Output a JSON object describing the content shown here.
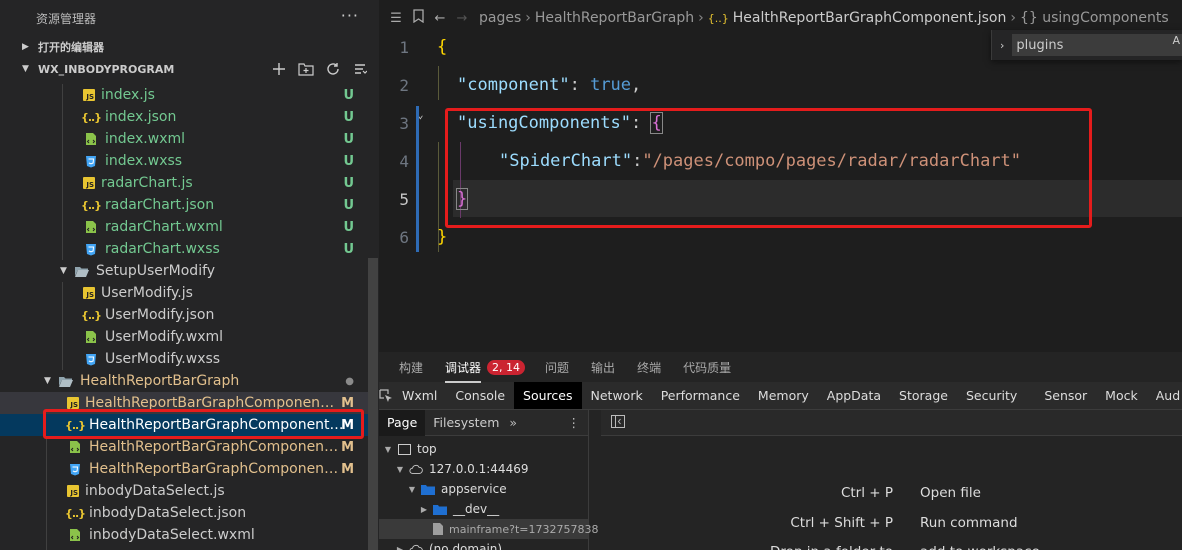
{
  "explorer": {
    "title": "资源管理器",
    "more": "···",
    "open_editors": "打开的编辑器",
    "project": "WX_INBODYPROGRAM",
    "files": [
      {
        "name": "index.js",
        "type": "js",
        "status": "U"
      },
      {
        "name": "index.json",
        "type": "json",
        "status": "U"
      },
      {
        "name": "index.wxml",
        "type": "wxml",
        "status": "U"
      },
      {
        "name": "index.wxss",
        "type": "wxss",
        "status": "U"
      },
      {
        "name": "radarChart.js",
        "type": "js",
        "status": "U"
      },
      {
        "name": "radarChart.json",
        "type": "json",
        "status": "U"
      },
      {
        "name": "radarChart.wxml",
        "type": "wxml",
        "status": "U"
      },
      {
        "name": "radarChart.wxss",
        "type": "wxss",
        "status": "U"
      }
    ],
    "folder_setup": "SetupUserModify",
    "setup_files": [
      {
        "name": "UserModify.js",
        "type": "js"
      },
      {
        "name": "UserModify.json",
        "type": "json"
      },
      {
        "name": "UserModify.wxml",
        "type": "wxml"
      },
      {
        "name": "UserModify.wxss",
        "type": "wxss"
      }
    ],
    "folder_health": "HealthReportBarGraph",
    "health_files": [
      {
        "name": "HealthReportBarGraphComponent.js",
        "type": "js",
        "status": "M"
      },
      {
        "name": "HealthReportBarGraphComponent.js...",
        "type": "json",
        "status": "M"
      },
      {
        "name": "HealthReportBarGraphComponent.w...",
        "type": "wxml",
        "status": "M"
      },
      {
        "name": "HealthReportBarGraphComponent.w...",
        "type": "wxss",
        "status": "M"
      }
    ],
    "tail_files": [
      {
        "name": "inbodyDataSelect.js",
        "type": "js"
      },
      {
        "name": "inbodyDataSelect.json",
        "type": "json"
      },
      {
        "name": "inbodyDataSelect.wxml",
        "type": "wxml"
      }
    ]
  },
  "breadcrumb": {
    "pages": "pages",
    "folder": "HealthReportBarGraph",
    "file": "HealthReportBarGraphComponent.json",
    "symbol": "{} usingComponents",
    "file_icon": "{..}"
  },
  "find_widget": {
    "value": "plugins",
    "aa": "A"
  },
  "code": {
    "lines": [
      "1",
      "2",
      "3",
      "4",
      "5",
      "6"
    ],
    "l1_open": "{",
    "l2_key": "\"component\"",
    "l2_colon": ": ",
    "l2_val": "true",
    "l2_comma": ",",
    "l3_key": "\"usingComponents\"",
    "l3_colon": ": ",
    "l3_open": "{",
    "l4_key": "\"SpiderChart\"",
    "l4_colon": ":",
    "l4_val": "\"/pages/compo/pages/radar/radarChart\"",
    "l5_close": "}",
    "l6_close": "}"
  },
  "devtools": {
    "tabs_top": [
      "构建",
      "调试器",
      "问题",
      "输出",
      "终端",
      "代码质量"
    ],
    "badge": "2, 14",
    "tabs_main": [
      "Wxml",
      "Console",
      "Sources",
      "Network",
      "Performance",
      "Memory",
      "AppData",
      "Storage",
      "Security",
      "Sensor",
      "Mock",
      "Aud"
    ],
    "sub_tabs": [
      "Page",
      "Filesystem"
    ],
    "more": "»",
    "kebab": "⋮",
    "tree": {
      "top": "top",
      "host": "127.0.0.1:44469",
      "appservice": "appservice",
      "dev": "__dev__",
      "mainframe": "mainframe?t=1732757838",
      "nodomain": "(no domain)"
    },
    "shortcuts": [
      {
        "keys": "Ctrl + P",
        "label": "Open file"
      },
      {
        "keys": "Ctrl + Shift + P",
        "label": "Run command"
      },
      {
        "keys": "Drop in a folder to",
        "label": "add to workspace"
      }
    ]
  },
  "colors": {
    "untracked": "#73c991",
    "modified": "#e2c08d",
    "highlight_box": "#e51c1c",
    "badge": "#cb2431"
  }
}
